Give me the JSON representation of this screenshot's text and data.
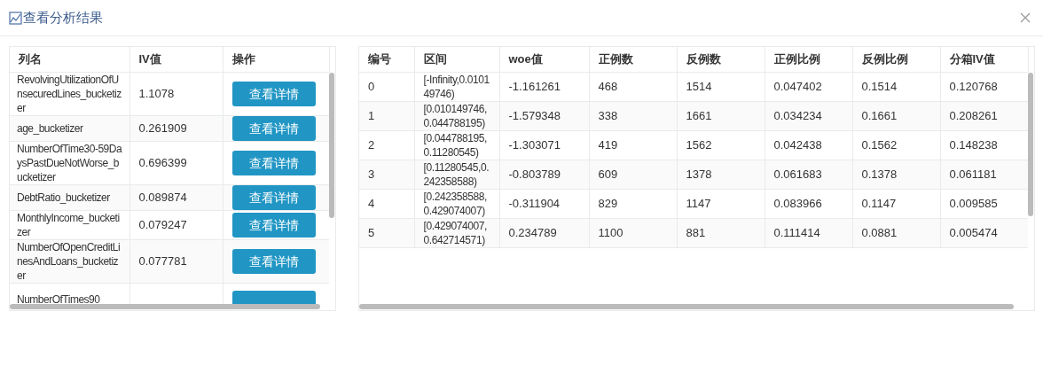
{
  "dialog": {
    "title": "查看分析结果"
  },
  "left_table": {
    "columns": [
      "列名",
      "IV值",
      "操作"
    ],
    "rows": [
      {
        "name": "RevolvingUtilizationOfUnsecuredLines_bucketizer",
        "iv": "1.1078",
        "button": "查看详情"
      },
      {
        "name": "age_bucketizer",
        "iv": "0.261909",
        "button": "查看详情"
      },
      {
        "name": "NumberOfTime30-59DaysPastDueNotWorse_bucketizer",
        "iv": "0.696399",
        "button": "查看详情"
      },
      {
        "name": "DebtRatio_bucketizer",
        "iv": "0.089874",
        "button": "查看详情"
      },
      {
        "name": "MonthlyIncome_bucketizer",
        "iv": "0.079247",
        "button": "查看详情"
      },
      {
        "name": "NumberOfOpenCreditLinesAndLoans_bucketizer",
        "iv": "0.077781",
        "button": "查看详情"
      },
      {
        "name": "NumberOfTimes90"
      }
    ]
  },
  "right_table": {
    "columns": [
      "编号",
      "区间",
      "woe值",
      "正例数",
      "反例数",
      "正例比例",
      "反例比例",
      "分箱IV值"
    ],
    "rows": [
      [
        "0",
        "[-Infinity,0.010149746)",
        "-1.161261",
        "468",
        "1514",
        "0.047402",
        "0.1514",
        "0.120768"
      ],
      [
        "1",
        "[0.010149746,0.044788195)",
        "-1.579348",
        "338",
        "1661",
        "0.034234",
        "0.1661",
        "0.208261"
      ],
      [
        "2",
        "[0.044788195,0.11280545)",
        "-1.303071",
        "419",
        "1562",
        "0.042438",
        "0.1562",
        "0.148238"
      ],
      [
        "3",
        "[0.11280545,0.242358588)",
        "-0.803789",
        "609",
        "1378",
        "0.061683",
        "0.1378",
        "0.061181"
      ],
      [
        "4",
        "[0.242358588,0.429074007)",
        "-0.311904",
        "829",
        "1147",
        "0.083966",
        "0.1147",
        "0.009585"
      ],
      [
        "5",
        "[0.429074007,0.642714571)",
        "0.234789",
        "1100",
        "881",
        "0.111414",
        "0.0881",
        "0.005474"
      ]
    ]
  }
}
